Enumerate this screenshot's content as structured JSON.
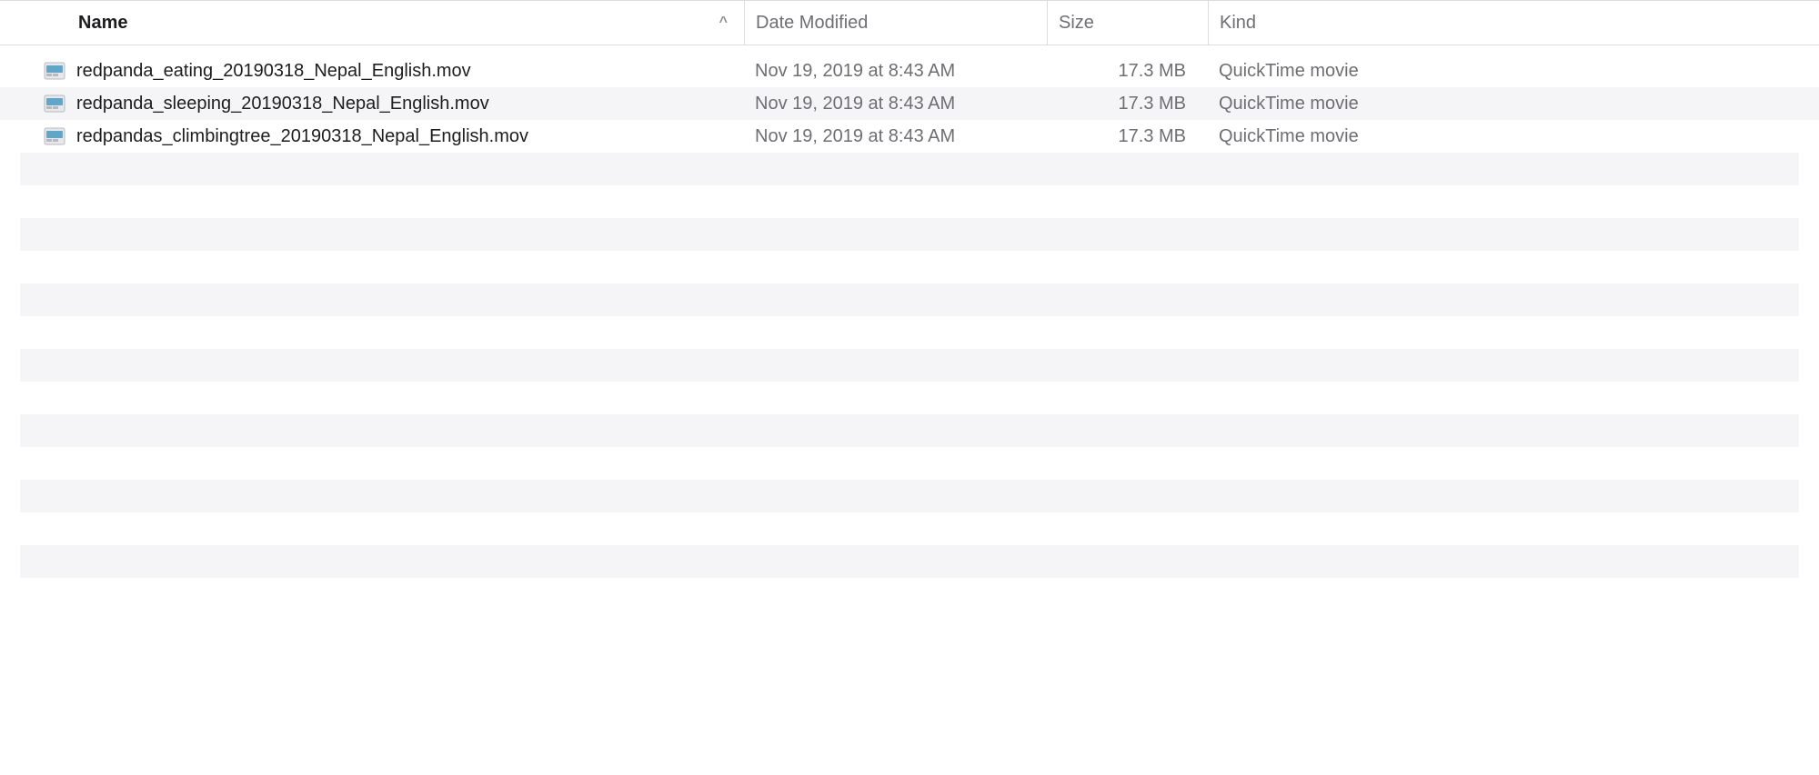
{
  "columns": {
    "name": "Name",
    "date_modified": "Date Modified",
    "size": "Size",
    "kind": "Kind"
  },
  "sort": {
    "column": "name",
    "direction": "ascending"
  },
  "files": [
    {
      "name": "redpanda_eating_20190318_Nepal_English.mov",
      "date_modified": "Nov 19, 2019 at 8:43 AM",
      "size": "17.3 MB",
      "kind": "QuickTime movie"
    },
    {
      "name": "redpanda_sleeping_20190318_Nepal_English.mov",
      "date_modified": "Nov 19, 2019 at 8:43 AM",
      "size": "17.3 MB",
      "kind": "QuickTime movie"
    },
    {
      "name": "redpandas_climbingtree_20190318_Nepal_English.mov",
      "date_modified": "Nov 19, 2019 at 8:43 AM",
      "size": "17.3 MB",
      "kind": "QuickTime movie"
    }
  ]
}
